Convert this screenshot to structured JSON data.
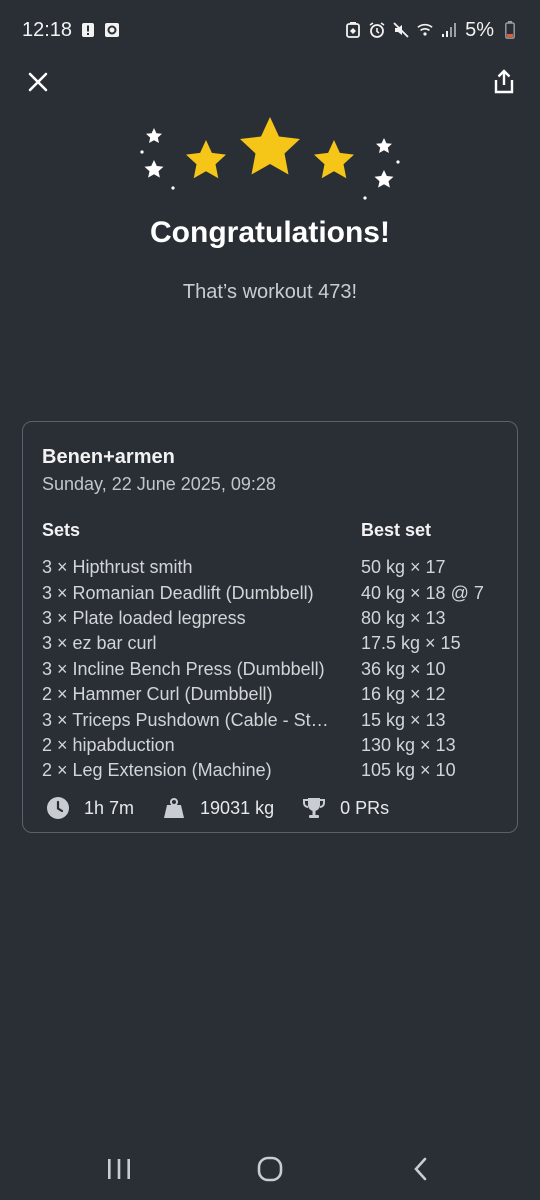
{
  "status_bar": {
    "time": "12:18",
    "battery_percent": "5%",
    "left_icons": [
      "alert-icon",
      "screenshot-icon"
    ],
    "right_icons": [
      "battery-saver-icon",
      "alarm-icon",
      "mute-icon",
      "wifi-icon",
      "signal-icon",
      "battery-icon"
    ]
  },
  "header": {
    "close_icon": "close-icon",
    "share_icon": "share-icon"
  },
  "celebration": {
    "title": "Congratulations!",
    "subtitle": "That’s workout 473!",
    "star_color": "#f5c518"
  },
  "workout": {
    "name": "Benen+armen",
    "date": "Sunday, 22 June 2025, 09:28",
    "sets_header": "Sets",
    "best_header": "Best set",
    "exercises": [
      {
        "sets": "3 × Hipthrust smith",
        "best": "50 kg × 17"
      },
      {
        "sets": "3 × Romanian Deadlift (Dumbbell)",
        "best": "40 kg × 18 @ 7"
      },
      {
        "sets": "3 × Plate loaded legpress",
        "best": "80 kg × 13"
      },
      {
        "sets": "3 × ez bar curl",
        "best": "17.5 kg × 15"
      },
      {
        "sets": "3 × Incline Bench Press (Dumbbell)",
        "best": "36 kg × 10"
      },
      {
        "sets": "2 × Hammer Curl (Dumbbell)",
        "best": "16 kg × 12"
      },
      {
        "sets": "3 × Triceps Pushdown (Cable - St…",
        "best": "15 kg × 13"
      },
      {
        "sets": "2 × hipabduction",
        "best": "130 kg × 13"
      },
      {
        "sets": "2 × Leg Extension (Machine)",
        "best": "105 kg × 10"
      }
    ],
    "stats": {
      "duration": "1h 7m",
      "volume": "19031 kg",
      "prs": "0 PRs"
    }
  },
  "nav": {
    "recents_icon": "recents-icon",
    "home_icon": "home-icon",
    "back_icon": "back-icon"
  }
}
